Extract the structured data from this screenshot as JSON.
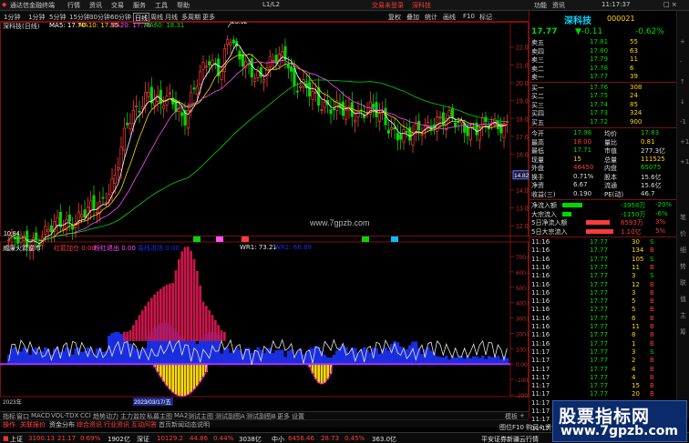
{
  "titlebar": {
    "app": "通达信金融终端",
    "menus": [
      "行情",
      "资讯",
      "交易",
      "服务",
      "工具",
      "帮助"
    ],
    "level": "L1/L2",
    "ads": [
      "交易未登录",
      "深科技"
    ],
    "right": [
      "功能",
      "资讯",
      "11:17:37"
    ],
    "winbtn": "□ ×"
  },
  "toolbar": {
    "periods": [
      "1分钟",
      "1分钟",
      "5分钟",
      "15分钟",
      "30分钟",
      "60分钟"
    ],
    "items": [
      "日线",
      "周线",
      "月线",
      "多周期",
      "更多"
    ],
    "right": [
      "复权",
      "叠加",
      "统计",
      "画线",
      "F10",
      "标记"
    ],
    "selected": "日线"
  },
  "stock_header": {
    "name_label": "深科技(日线)",
    "ma5": "MA5: 17.70",
    "ma10": "MA10: 17.55",
    "ma20": "MA20: 17.78",
    "ma60": "MA60: 18.31"
  },
  "main_chart": {
    "hi_label": "23.52",
    "lo_label": "10.84",
    "cur_price_tag": "14.82",
    "watermark": "www.7gpzb.com",
    "signals": [
      "消",
      "决",
      "买",
      "减",
      "卖"
    ],
    "yticks": [
      "22.00",
      "21.00",
      "20.00",
      "19.00",
      "18.00",
      "17.00",
      "16.00",
      "15.00",
      "14.00",
      "13.00",
      "12.00"
    ]
  },
  "ind_header": {
    "name": "威廉火箭逆市",
    "a": "红箭加仓 0.00",
    "b": "粉红退出 0.00",
    "c": "周线进场 0.00",
    "wr": "WR1: 73.21",
    "wr2": "WR2: 66.89"
  },
  "ind_yticks": [
    "700.00",
    "600.00",
    "500.00",
    "400.00",
    "300.00",
    "200.00",
    "100.00",
    "0.00",
    "-100.00",
    "-200.00"
  ],
  "date_label": "2023/03/17/五",
  "year_label": "2023年",
  "tabs_row1": [
    "指标",
    "窗口",
    "MACD",
    "VOL-TDX",
    "CCI",
    "趋势动力",
    "主力监控",
    "私募主图",
    "MA2",
    "测试主图",
    "测试副图A",
    "测试副图B",
    "更多",
    "设置"
  ],
  "tabs_row2": [
    "操作",
    "关联报价",
    "资金分布",
    "综合资讯",
    "行业资讯",
    "互动问答",
    "首页新闻动态说明"
  ],
  "side_tabs": [
    "模板",
    "+",
    "-"
  ],
  "quote": {
    "title": "深科技",
    "code": "000021",
    "price": "17.77",
    "change": "▼-0.11",
    "pct": "-0.62%",
    "asks": [
      {
        "l": "卖五",
        "p": "17.81",
        "v": "55"
      },
      {
        "l": "卖四",
        "p": "17.80",
        "v": "63"
      },
      {
        "l": "卖三",
        "p": "17.79",
        "v": "11"
      },
      {
        "l": "卖二",
        "p": "17.78",
        "v": "6"
      },
      {
        "l": "卖一",
        "p": "17.77",
        "v": "39"
      }
    ],
    "bids": [
      {
        "l": "买一",
        "p": "17.76",
        "v": "308"
      },
      {
        "l": "买二",
        "p": "17.75",
        "v": "24"
      },
      {
        "l": "买三",
        "p": "17.74",
        "v": "85"
      },
      {
        "l": "买四",
        "p": "17.73",
        "v": "324"
      },
      {
        "l": "买五",
        "p": "17.72",
        "v": "900"
      }
    ],
    "stats": [
      {
        "a": "今开",
        "b": "17.98",
        "c": "均价",
        "d": "17.83"
      },
      {
        "a": "最高",
        "b": "18.00",
        "c": "量比",
        "d": "0.81"
      },
      {
        "a": "最低",
        "b": "17.71",
        "c": "市值",
        "d": "277.3亿"
      },
      {
        "a": "现量",
        "b": "15",
        "c": "总量",
        "d": "111525"
      },
      {
        "a": "外盘",
        "b": "46450",
        "c": "内盘",
        "d": "65075"
      },
      {
        "a": "换手",
        "b": "0.71%",
        "c": "股本",
        "d": "15.6亿"
      },
      {
        "a": "净资",
        "b": "6.67",
        "c": "流通",
        "d": "15.6亿"
      },
      {
        "a": "收益(三)",
        "b": "0.190",
        "c": "PE(动)",
        "d": "46.7"
      }
    ],
    "flows": [
      {
        "l": "净流入额",
        "v": "-3958万",
        "p": "-20%"
      },
      {
        "l": "大宗流入",
        "v": "-1150万",
        "p": "-6%"
      },
      {
        "l": "5日净流入额",
        "v": "6593万",
        "p": "3%"
      },
      {
        "l": "5日大宗流入",
        "v": "1.10亿",
        "p": "5%"
      }
    ],
    "ticks": [
      [
        "11:16",
        "17.77",
        "30",
        "S"
      ],
      [
        "11:16",
        "17.77",
        "134",
        "B"
      ],
      [
        "11:16",
        "17.77",
        "105",
        "S"
      ],
      [
        "11:16",
        "17.77",
        "11",
        "B"
      ],
      [
        "11:16",
        "17.77",
        "3",
        "S"
      ],
      [
        "11:16",
        "17.77",
        "12",
        "B"
      ],
      [
        "11:16",
        "17.77",
        "3",
        "B"
      ],
      [
        "11:16",
        "17.77",
        "5",
        "B"
      ],
      [
        "11:16",
        "17.77",
        "5",
        "B"
      ],
      [
        "11:16",
        "17.77",
        "6",
        "B"
      ],
      [
        "11:16",
        "17.77",
        "11",
        "B"
      ],
      [
        "11:16",
        "17.77",
        "8",
        "B"
      ],
      [
        "11:16",
        "17.77",
        "1",
        "B"
      ],
      [
        "11:17",
        "17.77",
        "3",
        "S"
      ],
      [
        "11:17",
        "17.77",
        "2",
        "B"
      ],
      [
        "11:17",
        "17.77",
        "4",
        "B"
      ],
      [
        "11:17",
        "17.77",
        "4",
        "B"
      ],
      [
        "11:17",
        "17.77",
        "15",
        "B"
      ],
      [
        "11:17",
        "17.77",
        "20",
        "B"
      ],
      [
        "11:17",
        "17.77",
        "12",
        "B"
      ],
      [
        "11:17",
        "17.77",
        "5",
        "B"
      ],
      [
        "11:17",
        "17.77",
        "8",
        "B"
      ],
      [
        "11:17",
        "17.77",
        "3",
        "B"
      ],
      [
        "11:17",
        "17.77",
        "14",
        "S"
      ],
      [
        "11:17",
        "17.77",
        "3",
        "S"
      ],
      [
        "11:17",
        "17.77",
        "3",
        "B"
      ]
    ],
    "rs_labels": [
      "笔",
      "价",
      "细",
      "势",
      "联",
      "值",
      "主",
      "筹"
    ]
  },
  "rscroll": [
    "+",
    "-",
    "↑",
    "↓",
    "-1",
    "+1",
    "+1"
  ],
  "status": {
    "sh": "上证",
    "sh_v": "3100.13",
    "sh_c": "21.17",
    "sh_p": "0.69%",
    "sh_a": "1902亿",
    "sz": "深证",
    "sz_v": "10129.2",
    "sz_c": "44.86",
    "sz_p": "0.44%",
    "sz_a": "3038亿",
    "cy": "中小",
    "cy_v": "6456.46",
    "cy_c": "28.73",
    "cy_p": "0.45%",
    "cy_a": "363.0亿",
    "right": "平安证券新疆云行情",
    "f10": "图位F10 购买4 资讯"
  },
  "watermark_box": {
    "t1": "股票指标网",
    "t2": "www.7gpzb.com"
  },
  "colors": {
    "up": "#ff3b3b",
    "down": "#00d800",
    "ma5": "#ffffff",
    "ma10": "#ffd800",
    "ma20": "#ff50ff",
    "ma60": "#00d800",
    "blue": "#1a2ee0",
    "crimson": "#c8164a",
    "gold": "#ffd800",
    "purple": "#b030ff",
    "white": "#e6e6e6",
    "frame": "#7a1010"
  }
}
